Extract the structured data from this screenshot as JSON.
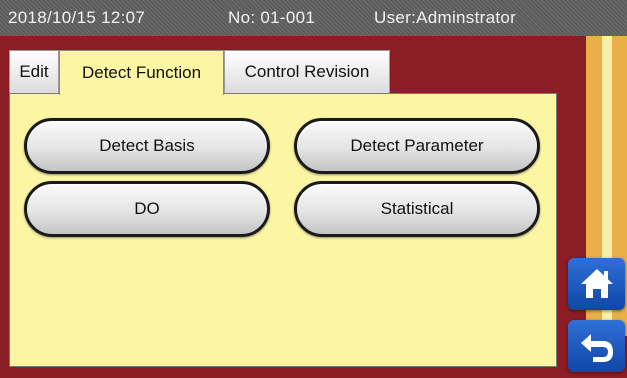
{
  "status_bar": {
    "datetime": "2018/10/15 12:07",
    "number": "No: 01-001",
    "user": "User:Adminstrator"
  },
  "tabs": [
    {
      "label": "Edit",
      "active": false
    },
    {
      "label": "Detect Function",
      "active": true
    },
    {
      "label": "Control Revision",
      "active": false
    }
  ],
  "buttons": {
    "detect_basis": "Detect Basis",
    "detect_parameter": "Detect Parameter",
    "do": "DO",
    "statistical": "Statistical"
  },
  "side_buttons": {
    "home_icon": "home-icon",
    "back_icon": "return-arrow-icon"
  },
  "colors": {
    "background": "#8b1e24",
    "panel": "#fbf5a4",
    "accent_blue": "#1f5cc4",
    "stripe_gold": "#e9b04a"
  }
}
